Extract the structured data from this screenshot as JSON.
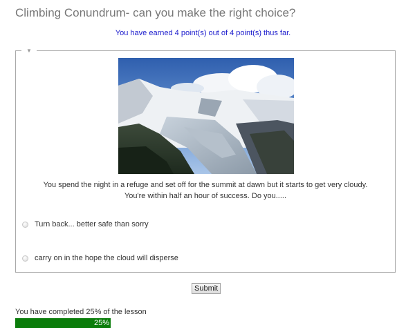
{
  "page": {
    "title": "Climbing Conundrum- can you make the right choice?",
    "points_message": "You have earned 4 point(s) out of 4 point(s) thus far."
  },
  "question": {
    "collapse_icon": "triangle-down-icon",
    "image_description_icon": "mountain-photo",
    "text_line_1": "You spend the night in a refuge and set off for the summit at dawn but it starts to get very cloudy.",
    "text_line_2": "You're within half an hour of success. Do you.....",
    "choices": [
      {
        "label": "Turn back... better safe than sorry",
        "selected": false
      },
      {
        "label": "carry on in the hope the cloud will disperse",
        "selected": false
      }
    ]
  },
  "submit_label": "Submit",
  "progress": {
    "label": "You have completed 25% of the lesson",
    "percent": 25,
    "value_text": "25%",
    "color": "#0b7d0b"
  }
}
